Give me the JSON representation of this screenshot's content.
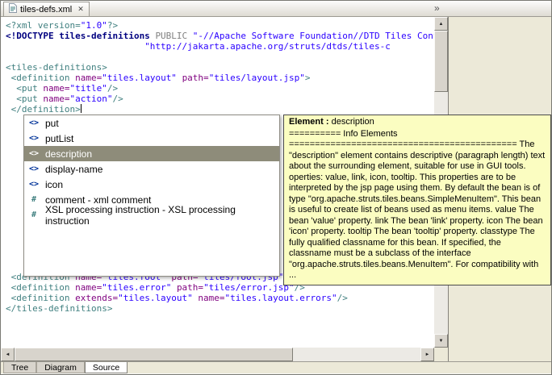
{
  "editor_tab": {
    "title": "tiles-defs.xml"
  },
  "icons": {
    "close_glyph": "✕",
    "tab_overflow_glyph": "»",
    "up_arrow": "▲",
    "down_arrow": "▼",
    "left_arrow": "◄",
    "right_arrow": "►"
  },
  "colors": {
    "c_tag": "#3f7f7f",
    "c_attr": "#7f007f",
    "c_val": "#2a00ff",
    "c_doctype": "#000080",
    "c_keyword": "#808080",
    "sel_bg": "#8e8c7a",
    "tooltip_bg": "#fbfdc1",
    "chrome_bg": "#ece9d8"
  },
  "editor": {
    "lines": [
      {
        "tokens": [
          {
            "t": "<?xml version=",
            "c": "tag"
          },
          {
            "t": "\"1.0\"",
            "c": "val"
          },
          {
            "t": "?>",
            "c": "tag"
          }
        ]
      },
      {
        "tokens": [
          {
            "t": "<!DOCTYPE tiles-definitions ",
            "c": "doctype"
          },
          {
            "t": "PUBLIC ",
            "c": "pub"
          },
          {
            "t": "\"-//Apache Software Foundation//DTD Tiles Conf",
            "c": "val"
          }
        ]
      },
      {
        "tokens": [
          {
            "t": "                          ",
            "c": "plain"
          },
          {
            "t": "\"http://jakarta.apache.org/struts/dtds/tiles-c",
            "c": "val"
          }
        ]
      },
      {
        "tokens": []
      },
      {
        "tokens": [
          {
            "t": "<tiles-definitions>",
            "c": "tag"
          }
        ]
      },
      {
        "tokens": [
          {
            "t": " <definition ",
            "c": "tag"
          },
          {
            "t": "name=",
            "c": "attr"
          },
          {
            "t": "\"tiles.layout\"",
            "c": "val"
          },
          {
            "t": " ",
            "c": "plain"
          },
          {
            "t": "path=",
            "c": "attr"
          },
          {
            "t": "\"tiles/layout.jsp\"",
            "c": "val"
          },
          {
            "t": ">",
            "c": "tag"
          }
        ]
      },
      {
        "tokens": [
          {
            "t": "  <put ",
            "c": "tag"
          },
          {
            "t": "name=",
            "c": "attr"
          },
          {
            "t": "\"title\"",
            "c": "val"
          },
          {
            "t": "/>",
            "c": "tag"
          }
        ]
      },
      {
        "tokens": [
          {
            "t": "  <put ",
            "c": "tag"
          },
          {
            "t": "name=",
            "c": "attr"
          },
          {
            "t": "\"action\"",
            "c": "val"
          },
          {
            "t": "/>",
            "c": "tag"
          }
        ]
      },
      {
        "tokens": [
          {
            "t": " </definition>",
            "c": "tag"
          }
        ],
        "caret": true
      },
      {
        "tokens": []
      },
      {
        "tokens": []
      },
      {
        "tokens": []
      },
      {
        "tokens": []
      },
      {
        "tokens": []
      },
      {
        "tokens": []
      },
      {
        "tokens": []
      },
      {
        "tokens": []
      },
      {
        "tokens": []
      },
      {
        "tokens": []
      },
      {
        "tokens": []
      },
      {
        "tokens": []
      },
      {
        "tokens": []
      },
      {
        "tokens": []
      },
      {
        "tokens": []
      },
      {
        "tokens": [
          {
            "t": " <definition ",
            "c": "tag"
          },
          {
            "t": "name=",
            "c": "attr"
          },
          {
            "t": "\"tiles.foot\"",
            "c": "val"
          },
          {
            "t": " ",
            "c": "plain"
          },
          {
            "t": "path=",
            "c": "attr"
          },
          {
            "t": "\"tiles/foot.jsp\"",
            "c": "val"
          },
          {
            "t": "/>",
            "c": "tag"
          }
        ]
      },
      {
        "tokens": [
          {
            "t": " <definition ",
            "c": "tag"
          },
          {
            "t": "name=",
            "c": "attr"
          },
          {
            "t": "\"tiles.error\"",
            "c": "val"
          },
          {
            "t": " ",
            "c": "plain"
          },
          {
            "t": "path=",
            "c": "attr"
          },
          {
            "t": "\"tiles/error.jsp\"",
            "c": "val"
          },
          {
            "t": "/>",
            "c": "tag"
          }
        ]
      },
      {
        "tokens": [
          {
            "t": " <definition ",
            "c": "tag"
          },
          {
            "t": "extends=",
            "c": "attr"
          },
          {
            "t": "\"tiles.layout\"",
            "c": "val"
          },
          {
            "t": " ",
            "c": "plain"
          },
          {
            "t": "name=",
            "c": "attr"
          },
          {
            "t": "\"tiles.layout.errors\"",
            "c": "val"
          },
          {
            "t": "/>",
            "c": "tag"
          }
        ]
      },
      {
        "tokens": [
          {
            "t": "</tiles-definitions>",
            "c": "tag"
          }
        ]
      }
    ]
  },
  "popup": {
    "items": [
      {
        "kind": "element",
        "glyph": "<>",
        "label": "put",
        "selected": false
      },
      {
        "kind": "element",
        "glyph": "<>",
        "label": "putList",
        "selected": false
      },
      {
        "kind": "element",
        "glyph": "<>",
        "label": "description",
        "selected": true
      },
      {
        "kind": "element",
        "glyph": "<>",
        "label": "display-name",
        "selected": false
      },
      {
        "kind": "element",
        "glyph": "<>",
        "label": "icon",
        "selected": false
      },
      {
        "kind": "comment",
        "glyph": "#",
        "label": "comment - xml comment",
        "selected": false
      },
      {
        "kind": "comment",
        "glyph": "#",
        "label": "XSL processing instruction - XSL processing instruction",
        "selected": false
      }
    ]
  },
  "tooltip": {
    "title_label": "Element :",
    "title_value": "description",
    "subtitle": "========== Info Elements",
    "body": "============================================ The \"description\" element contains descriptive (paragraph length) text about the surrounding element, suitable for use in GUI tools. operties: value, link, icon, tooltip. This properties are to be interpreted by the jsp page using them. By default the bean is of type \"org.apache.struts.tiles.beans.SimpleMenuItem\". This bean is useful to create list of beans used as menu items. value The bean 'value' property. link The bean 'link' property. icon The bean 'icon' property. tooltip The bean 'tooltip' property. classtype The fully qualified classname for this bean. If specified, the classname must be a subclass of the interface \"org.apache.struts.tiles.beans.MenuItem\". For compatibility with",
    "ellipsis": "..."
  },
  "bottom_tabs": {
    "items": [
      {
        "label": "Tree",
        "active": false
      },
      {
        "label": "Diagram",
        "active": false
      },
      {
        "label": "Source",
        "active": true
      }
    ]
  }
}
